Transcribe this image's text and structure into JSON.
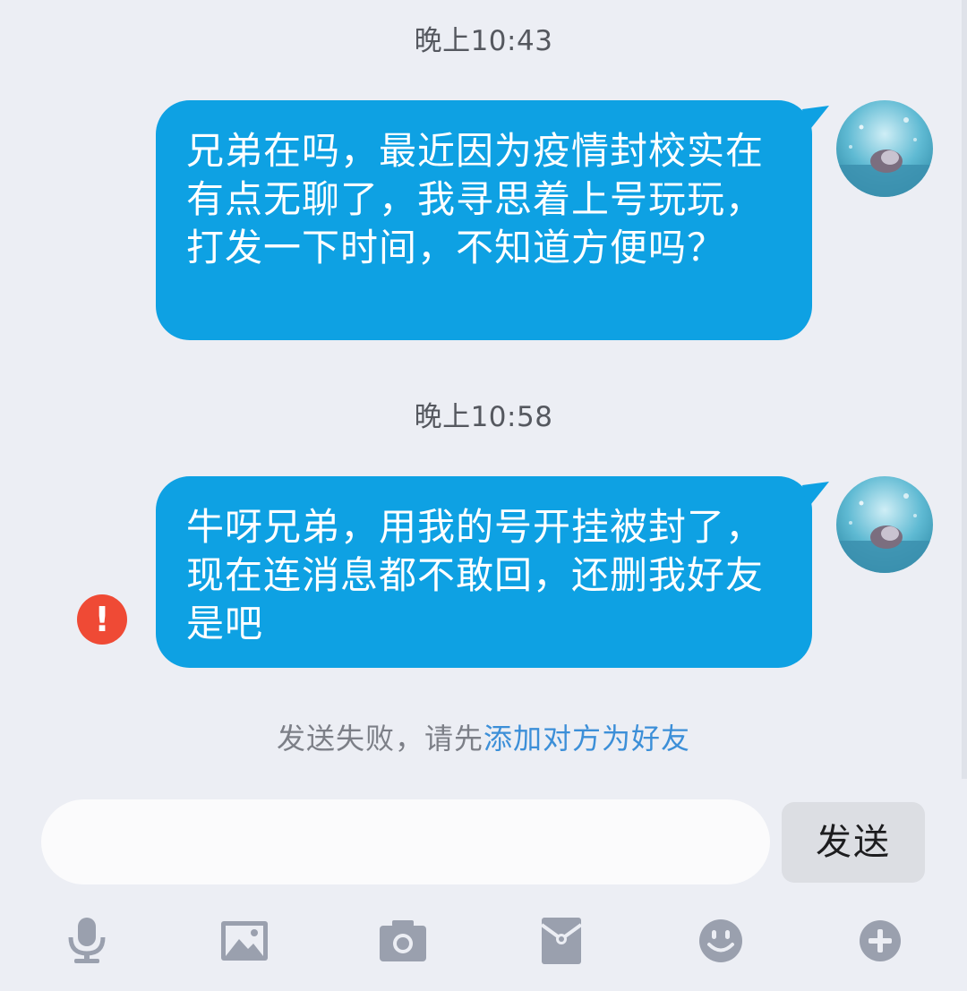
{
  "messages": [
    {
      "time": "晚上10:43",
      "text": "兄弟在吗，最近因为疫情封校实在有点无聊了，我寻思着上号玩玩，打发一下时间，不知道方便吗？",
      "failed": false
    },
    {
      "time": "晚上10:58",
      "text": "牛呀兄弟，用我的号开挂被封了，现在连消息都不敢回，还删我好友是吧",
      "failed": true
    }
  ],
  "error_mark": "!",
  "fail_note": {
    "prefix": "发送失败，请先",
    "link": "添加对方为好友"
  },
  "composer": {
    "input_value": "",
    "placeholder": "",
    "send_label": "发送"
  },
  "toolbar": {
    "items": [
      {
        "icon": "microphone-icon"
      },
      {
        "icon": "image-icon"
      },
      {
        "icon": "camera-icon"
      },
      {
        "icon": "red-packet-icon"
      },
      {
        "icon": "emoji-icon"
      },
      {
        "icon": "plus-icon"
      }
    ]
  },
  "colors": {
    "bubble": "#0ea1e3",
    "background": "#eceef4",
    "error": "#ef4a35",
    "link": "#3c8fd8",
    "icon": "#9aa0ae"
  }
}
